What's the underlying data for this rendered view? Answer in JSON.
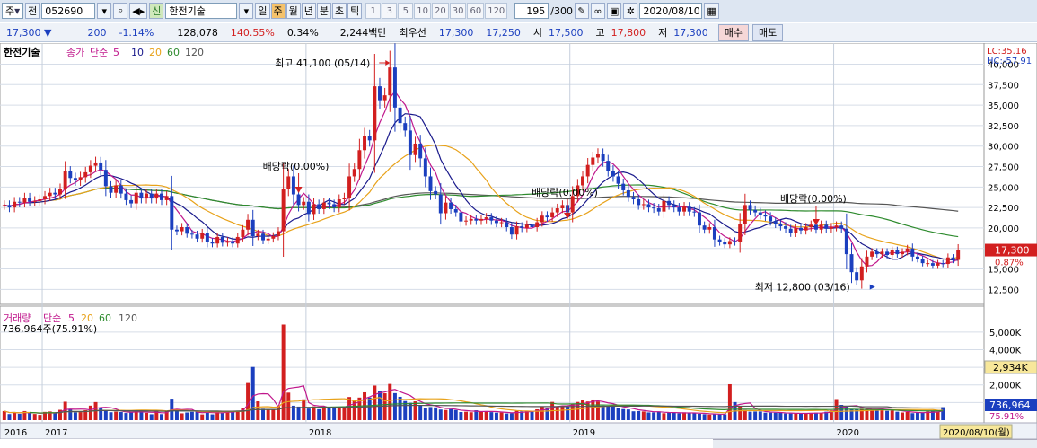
{
  "toolbar": {
    "market": "주",
    "market_kind": "전",
    "code": "052690",
    "sin_badge": "신",
    "stock_name": "한전기술",
    "periods": [
      "일",
      "주",
      "월",
      "년",
      "분",
      "초",
      "틱"
    ],
    "active_period": "주",
    "intervals": [
      "1",
      "3",
      "5",
      "10",
      "20",
      "30",
      "60",
      "120"
    ],
    "count": "195",
    "count_total": "/300",
    "date": "2020/08/10",
    "icons": [
      "search-icon",
      "speaker-icon",
      "dropdown-icon",
      "pen-icon",
      "link-icon",
      "save-icon",
      "settings-icon",
      "calendar-icon"
    ]
  },
  "quote": {
    "price": "17,300",
    "change": "200",
    "change_pct": "-1.14%",
    "volume": "128,078",
    "vol_ratio": "140.55%",
    "turnover": "0.34%",
    "amount": "2,244백만",
    "priority_label": "최우선",
    "ask": "17,300",
    "bid": "17,250",
    "open_label": "시",
    "open": "17,500",
    "high_label": "고",
    "high": "17,800",
    "low_label": "저",
    "low": "17,300",
    "buy_label": "매수",
    "sell_label": "매도"
  },
  "chart_data": [
    {
      "type": "candlestick",
      "legend": [
        "한전기술",
        "종가",
        "단순",
        "5",
        "10",
        "20",
        "60",
        "120"
      ],
      "y_ticks": [
        12500,
        15000,
        17500,
        20000,
        22500,
        25000,
        27500,
        30000,
        32500,
        35000,
        37500,
        40000
      ],
      "x_labels": [
        "2016",
        "2017",
        "2018",
        "2019",
        "2020"
      ],
      "last_price": 17300,
      "last_pct": "0.87%",
      "top_right": [
        "LC:35.16",
        "HC:-57.91"
      ],
      "annotations": [
        {
          "text": "최고 41,100 (05/14)",
          "value": 41100
        },
        {
          "text": "최저 12,800 (03/16)",
          "value": 12800
        },
        {
          "text": "배당락(0.00%)"
        },
        {
          "text": "배당락(0.00%)"
        },
        {
          "text": "배당락(0.00%)"
        }
      ],
      "series_colors": {
        "up": "#d21f1f",
        "down": "#1b3fbf",
        "ma5": "#c0188c",
        "ma10": "#1a1a8c",
        "ma20": "#e8a21a",
        "ma60": "#2e8b2e",
        "ma120": "#555555"
      },
      "closes": [
        22800,
        22500,
        23200,
        23100,
        23700,
        23200,
        23300,
        23500,
        23900,
        24300,
        24100,
        24800,
        26900,
        26100,
        25800,
        26200,
        26800,
        27600,
        28000,
        27100,
        25100,
        24300,
        25200,
        24200,
        23400,
        23000,
        24300,
        23600,
        24200,
        23600,
        24200,
        23400,
        23900,
        19800,
        19600,
        20100,
        19300,
        19200,
        18700,
        19400,
        18300,
        18100,
        18900,
        18200,
        18400,
        18100,
        18900,
        19800,
        21000,
        19000,
        19300,
        18500,
        18700,
        19000,
        19600,
        24800,
        26300,
        24100,
        22800,
        23200,
        21700,
        22900,
        22300,
        23100,
        22900,
        22500,
        23500,
        23700,
        26300,
        27200,
        29500,
        31200,
        30700,
        37300,
        35600,
        36200,
        39600,
        34700,
        32800,
        31900,
        28900,
        30300,
        28500,
        26300,
        24500,
        24100,
        21800,
        23100,
        22300,
        21900,
        20800,
        20900,
        21100,
        20900,
        21100,
        21300,
        20900,
        20600,
        20700,
        20100,
        19200,
        20200,
        20000,
        20400,
        20100,
        20700,
        21500,
        21300,
        21900,
        22400,
        22800,
        21900,
        23900,
        25200,
        26300,
        27700,
        28600,
        29000,
        28200,
        27000,
        26300,
        25400,
        24600,
        23800,
        23500,
        22800,
        22900,
        22500,
        22400,
        22000,
        23300,
        22800,
        22500,
        22000,
        22600,
        22000,
        21900,
        20300,
        19800,
        20100,
        18600,
        18300,
        18000,
        18400,
        18300,
        20500,
        22800,
        22200,
        21900,
        21600,
        21400,
        20800,
        20500,
        20200,
        19900,
        19400,
        20000,
        19700,
        20100,
        20400,
        19800,
        20400,
        19900,
        20100,
        20300,
        19900,
        16800,
        14600,
        13600,
        15300,
        16500,
        17100,
        16800,
        17100,
        16700,
        17300,
        16800,
        17100,
        17500,
        16500,
        16200,
        15700,
        15700,
        15400,
        15700,
        15600,
        16400,
        16100,
        17300
      ]
    },
    {
      "type": "bar",
      "legend": [
        "거래량",
        "단순",
        "5",
        "20",
        "60",
        "120"
      ],
      "summary": "736,964주(75.91%)",
      "y_ticks": [
        "5,000K",
        "4,000K",
        "3,000K",
        "2,000K",
        "1,000K"
      ],
      "y_tick_values": [
        5000,
        4000,
        3000,
        2000,
        1000
      ],
      "marker_value": "2,934K",
      "last_value": "736,964",
      "last_pct": "75.91%",
      "unit": "K",
      "volumes": [
        512,
        346,
        442,
        360,
        512,
        415,
        350,
        300,
        466,
        489,
        408,
        583,
        1046,
        602,
        440,
        454,
        565,
        823,
        1025,
        693,
        528,
        447,
        480,
        457,
        404,
        440,
        523,
        499,
        415,
        334,
        493,
        341,
        516,
        1218,
        515,
        384,
        433,
        467,
        489,
        325,
        504,
        328,
        457,
        440,
        508,
        533,
        537,
        667,
        2108,
        3020,
        1069,
        647,
        598,
        600,
        813,
        5424,
        1562,
        819,
        768,
        1182,
        656,
        781,
        619,
        750,
        693,
        728,
        701,
        782,
        1314,
        1135,
        1283,
        1580,
        1286,
        1963,
        1637,
        1526,
        2056,
        1534,
        1326,
        1084,
        984,
        1067,
        865,
        680,
        742,
        722,
        599,
        573,
        622,
        569,
        458,
        476,
        446,
        559,
        479,
        513,
        452,
        422,
        429,
        377,
        383,
        525,
        496,
        524,
        500,
        612,
        738,
        705,
        1035,
        776,
        807,
        764,
        895,
        1033,
        1159,
        1059,
        1172,
        1060,
        823,
        786,
        839,
        694,
        626,
        603,
        499,
        512,
        490,
        435,
        439,
        490,
        391,
        411,
        418,
        383,
        442,
        404,
        394,
        357,
        338,
        315,
        356,
        331,
        332,
        2038,
        1025,
        763,
        569,
        474,
        487,
        488,
        421,
        424,
        420,
        407,
        376,
        378,
        367,
        400,
        386,
        412,
        419,
        409,
        475,
        549,
        1197,
        866,
        795,
        622,
        634,
        648,
        638,
        592,
        615,
        659,
        525,
        536,
        476,
        432,
        461,
        394,
        407,
        418,
        487,
        513,
        467,
        735
      ]
    }
  ],
  "status": {
    "x_labels": [
      "2016",
      "2017",
      "2018",
      "2019",
      "2020"
    ],
    "cursor_date": "2020/08/10(월)"
  }
}
